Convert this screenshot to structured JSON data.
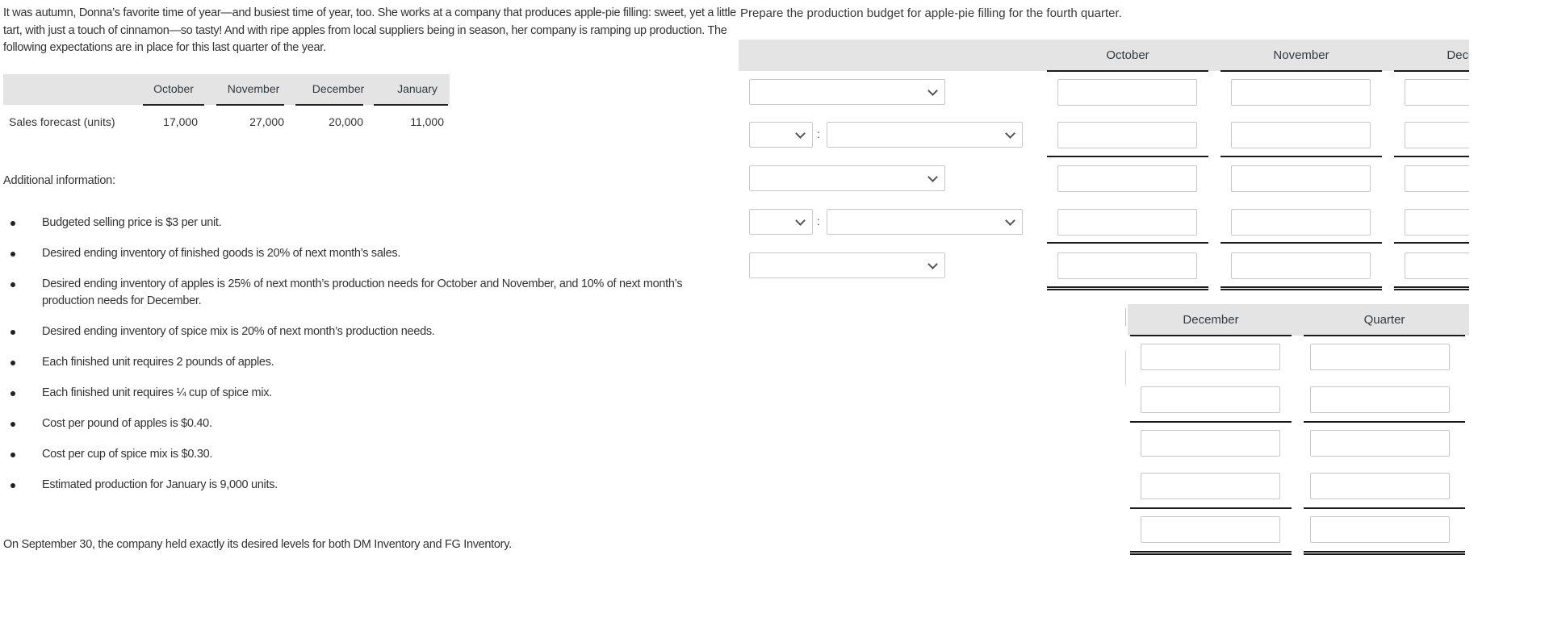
{
  "intro": {
    "paragraph": "It was autumn, Donna’s favorite time of year—and busiest time of year, too. She works at a company that produces apple-pie filling: sweet, yet a little tart, with just a touch of cinnamon—so tasty! And with ripe apples from local suppliers being in season, her company is ramping up production. The following expectations are in place for this last quarter of the year."
  },
  "sales_table": {
    "columns": [
      "October",
      "November",
      "December",
      "January"
    ],
    "row_label": "Sales forecast (units)",
    "values": [
      "17,000",
      "27,000",
      "20,000",
      "11,000"
    ]
  },
  "additional": {
    "heading": "Additional information:",
    "items": [
      "Budgeted selling price is $3 per unit.",
      "Desired ending inventory of finished goods is 20% of next month’s sales.",
      "Desired ending inventory of apples is 25% of next month’s production needs for October and November, and 10% of next month’s production needs for December.",
      "Desired ending inventory of spice mix is 20% of next month’s production needs.",
      "Each finished unit requires 2 pounds of apples.",
      "Each finished unit requires ¼ cup of spice mix.",
      "Cost per pound of apples is $0.40.",
      "Cost per cup of spice mix is $0.30.",
      "Estimated production for January is 9,000 units."
    ],
    "note": "On September 30, the company held exactly its desired levels for both DM Inventory and FG Inventory."
  },
  "budget": {
    "prompt": "Prepare the production budget for apple-pie filling for the fourth quarter.",
    "columns_top": [
      "October",
      "November",
      "December"
    ],
    "columns_bottom": [
      "December",
      "Quarter"
    ],
    "rows": [
      {
        "type": "select",
        "selected": "",
        "values": [
          "",
          "",
          "",
          ""
        ]
      },
      {
        "type": "select-pair",
        "selected_op": "",
        "selected": "",
        "colon": ":",
        "values": [
          "",
          "",
          "",
          ""
        ]
      },
      {
        "type": "select",
        "selected": "",
        "values": [
          "",
          "",
          "",
          ""
        ]
      },
      {
        "type": "select-pair",
        "selected_op": "",
        "selected": "",
        "colon": ":",
        "values": [
          "",
          "",
          "",
          ""
        ]
      },
      {
        "type": "select",
        "selected": "",
        "values": [
          "",
          "",
          "",
          ""
        ]
      }
    ]
  }
}
